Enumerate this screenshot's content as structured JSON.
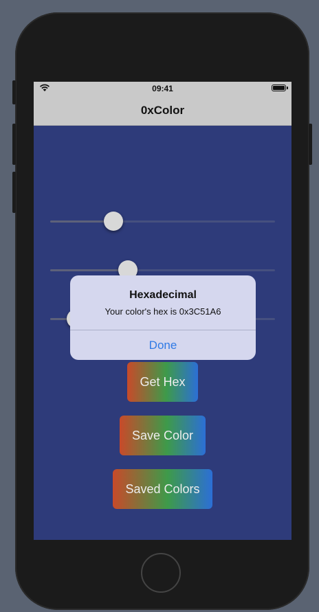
{
  "status_bar": {
    "time": "09:41",
    "wifi_icon": "wifi-icon",
    "battery_icon": "battery-icon"
  },
  "navbar": {
    "title": "0xColor"
  },
  "sliders": [
    {
      "name": "red",
      "value_fraction": 0.26
    },
    {
      "name": "green",
      "value_fraction": 0.33
    },
    {
      "name": "blue",
      "value_fraction": 0.08
    }
  ],
  "buttons": {
    "get_hex": "Get Hex",
    "save_color": "Save Color",
    "saved_colors": "Saved Colors"
  },
  "colors": {
    "screen_background": "#2e3b7a",
    "button_gradient": [
      "#c84a2a",
      "#3e9a4a",
      "#2c6fd6"
    ],
    "alert_action": "#2f7ae5"
  },
  "alert": {
    "title": "Hexadecimal",
    "message": "Your color's hex is 0x3C51A6",
    "action": "Done"
  }
}
